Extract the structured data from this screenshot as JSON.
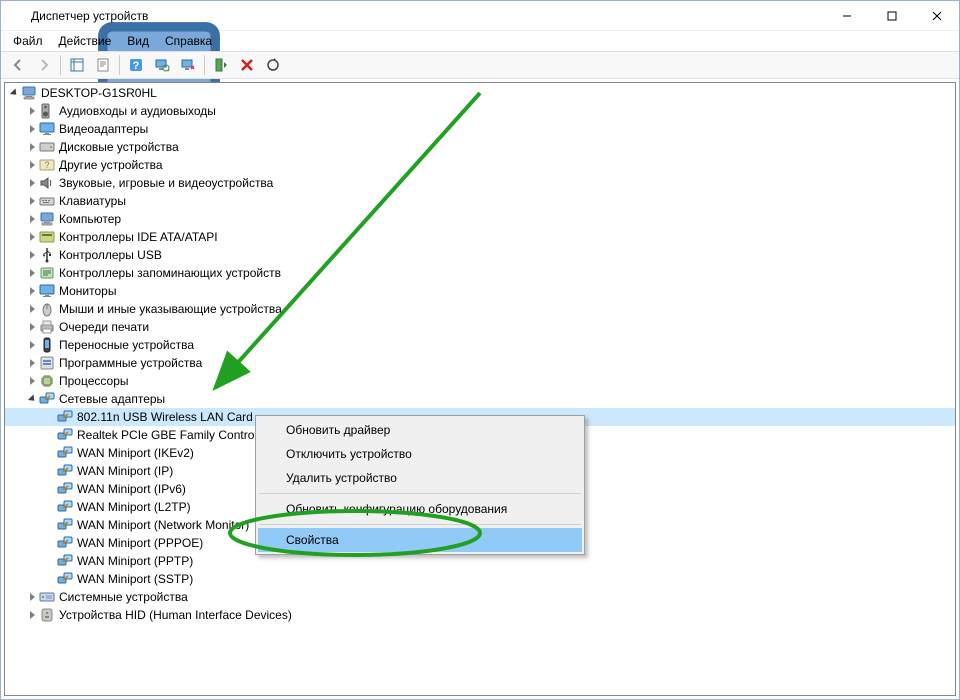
{
  "window": {
    "title": "Диспетчер устройств"
  },
  "menubar": {
    "file": "Файл",
    "action": "Действие",
    "view": "Вид",
    "help": "Справка"
  },
  "tree": {
    "root": "DESKTOP-G1SR0HL",
    "cat0": "Аудиовходы и аудиовыходы",
    "cat1": "Видеоадаптеры",
    "cat2": "Дисковые устройства",
    "cat3": "Другие устройства",
    "cat4": "Звуковые, игровые и видеоустройства",
    "cat5": "Клавиатуры",
    "cat6": "Компьютер",
    "cat7": "Контроллеры IDE ATA/ATAPI",
    "cat8": "Контроллеры USB",
    "cat9": "Контроллеры запоминающих устройств",
    "cat10": "Мониторы",
    "cat11": "Мыши и иные указывающие устройства",
    "cat12": "Очереди печати",
    "cat13": "Переносные устройства",
    "cat14": "Программные устройства",
    "cat15": "Процессоры",
    "cat16": "Сетевые адаптеры",
    "net0": "802.11n USB Wireless LAN Card",
    "net1": "Realtek PCIe GBE Family Controller",
    "net2": "WAN Miniport (IKEv2)",
    "net3": "WAN Miniport (IP)",
    "net4": "WAN Miniport (IPv6)",
    "net5": "WAN Miniport (L2TP)",
    "net6": "WAN Miniport (Network Monitor)",
    "net7": "WAN Miniport (PPPOE)",
    "net8": "WAN Miniport (PPTP)",
    "net9": "WAN Miniport (SSTP)",
    "cat17": "Системные устройства",
    "cat18": "Устройства HID (Human Interface Devices)"
  },
  "context_menu": {
    "update_driver": "Обновить драйвер",
    "disable_device": "Отключить устройство",
    "remove_device": "Удалить устройство",
    "rescan": "Обновить конфигурацию оборудования",
    "properties": "Свойства"
  }
}
